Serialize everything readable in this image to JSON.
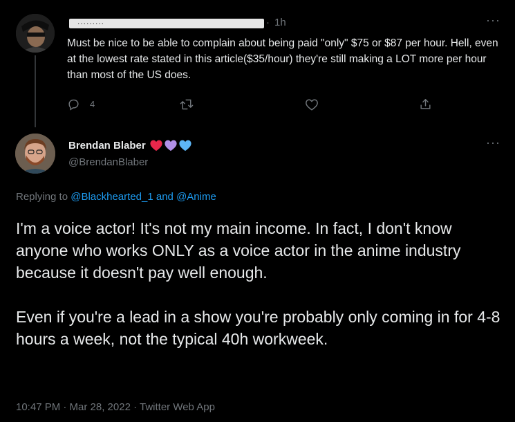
{
  "parent_tweet": {
    "time": "1h",
    "text": "Must be nice to be able to complain about being paid \"only\" $75 or $87 per hour. Hell, even at the lowest rate stated in this article($35/hour) they're still making a LOT more per hour than most of the US does.",
    "reply_count": "4",
    "more": "···"
  },
  "main_tweet": {
    "display_name": "Brendan Blaber",
    "handle": "@BrendanBlaber",
    "more": "···",
    "replying_prefix": "Replying to",
    "replying_user1": "@Blackhearted_1",
    "replying_and": "and",
    "replying_user2": "@Anime",
    "paragraph1": "I'm a voice actor! It's not my main income. In fact, I don't know anyone who works ONLY as a voice actor in the anime industry because it doesn't pay well enough.",
    "paragraph2": "Even if you're a lead in a show you're probably only coming in for 4-8 hours a week, not the typical 40h workweek.",
    "timestamp": "10:47 PM · Mar 28, 2022 · Twitter Web App"
  },
  "colors": {
    "background": "#000000",
    "text": "#e7e9ea",
    "muted": "#71767b",
    "link": "#1d9bf0",
    "heart_red": "#f91880",
    "heart_purple": "#b190e8",
    "heart_blue": "#5db5f5"
  },
  "icons": {
    "reply": "reply-icon",
    "retweet": "retweet-icon",
    "like": "heart-icon",
    "share": "share-icon",
    "more": "more-icon"
  }
}
